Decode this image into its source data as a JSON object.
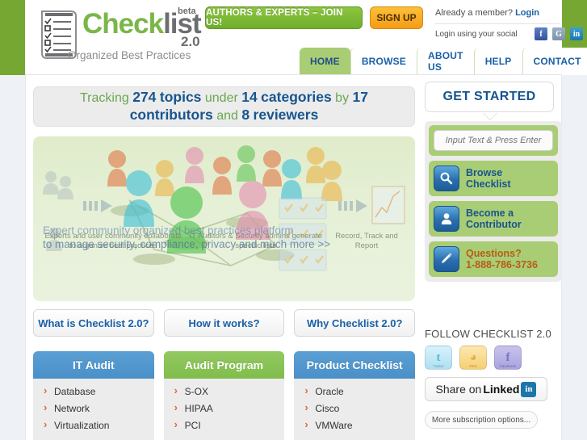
{
  "brand": {
    "name_check": "Check",
    "name_list": "list",
    "beta": "beta",
    "version": "2.0",
    "tagline": "Organized Best Practices",
    "logo_icon": "checklist-document-icon"
  },
  "header": {
    "authors_button": "AUTHORS & EXPERTS – JOIN US!",
    "signup_button": "SIGN UP",
    "member_prompt": "Already a member?",
    "login_link": "Login",
    "social_login_label": "Login using your social",
    "social_icons": [
      {
        "name": "facebook-icon",
        "glyph": "f"
      },
      {
        "name": "google-icon",
        "glyph": "G"
      },
      {
        "name": "linkedin-icon",
        "glyph": "in"
      }
    ]
  },
  "nav": {
    "items": [
      {
        "label": "HOME",
        "active": true
      },
      {
        "label": "BROWSE",
        "active": false
      },
      {
        "label": "ABOUT US",
        "active": false
      },
      {
        "label": "HELP",
        "active": false
      },
      {
        "label": "CONTACT",
        "active": false
      }
    ]
  },
  "stats": {
    "w_tracking": "Tracking",
    "topics_count": "274",
    "w_topics": "topics",
    "w_under": "under",
    "categories_count": "14",
    "w_categories": "categories",
    "w_by": "by",
    "contributors_count": "17",
    "w_contributors": "contributors",
    "w_and": "and",
    "reviewers_count": "8",
    "w_reviewers": "reviewers"
  },
  "hero": {
    "headline_line1": "Expert community organized best practices platform",
    "headline_line2": "to manage security, compliance, privacy and much more >>",
    "col1": "Experts and user community collaborate to organize best practices",
    "col2": "IT Auditors & Security admins generate specific lists",
    "col3": "Record, Track and Report"
  },
  "pills": [
    {
      "label": "What is Checklist 2.0?"
    },
    {
      "label": "How it works?"
    },
    {
      "label": "Why Checklist 2.0?"
    }
  ],
  "categories": [
    {
      "title": "IT Audit",
      "color": "blue",
      "items": [
        "Database",
        "Network",
        "Virtualization"
      ]
    },
    {
      "title": "Audit Program",
      "color": "green",
      "items": [
        "S-OX",
        "HIPAA",
        "PCI"
      ]
    },
    {
      "title": "Product Checklist",
      "color": "blue",
      "items": [
        "Oracle",
        "Cisco",
        "VMWare"
      ]
    }
  ],
  "sidebar": {
    "get_started_title": "GET STARTED",
    "search_placeholder": "Input Text & Press Enter",
    "search_value": "",
    "actions": [
      {
        "icon": "magnifier-icon",
        "line1": "Browse",
        "line2": "Checklist",
        "accent": "blue"
      },
      {
        "icon": "user-icon",
        "line1": "Become a",
        "line2": "Contributor",
        "accent": "blue"
      },
      {
        "icon": "pencil-icon",
        "line1": "Questions?",
        "line2": "1-888-786-3736",
        "accent": "orange"
      }
    ],
    "follow_title": "FOLLOW CHECKLIST 2.0",
    "follow_icons": [
      {
        "name": "twitter-icon",
        "glyph": "t",
        "caption": "Twitter"
      },
      {
        "name": "rss-icon",
        "glyph": "◕",
        "caption": "RSS"
      },
      {
        "name": "facebook-icon",
        "glyph": "f",
        "caption": "Facebook"
      }
    ],
    "linkedin_share_t1": "Share on ",
    "linkedin_share_t2": "Linked",
    "linkedin_badge": "in",
    "more_subscription": "More subscription options..."
  },
  "colors": {
    "brand_green": "#7ab648",
    "rail_green": "#76a733",
    "nav_blue": "#1a5fa8",
    "panel_green": "#a9cd74",
    "signup_orange": "#f59b14",
    "head_blue": "#4a90c8",
    "head_green": "#80bd4c",
    "bullet_orange": "#e2663a"
  }
}
